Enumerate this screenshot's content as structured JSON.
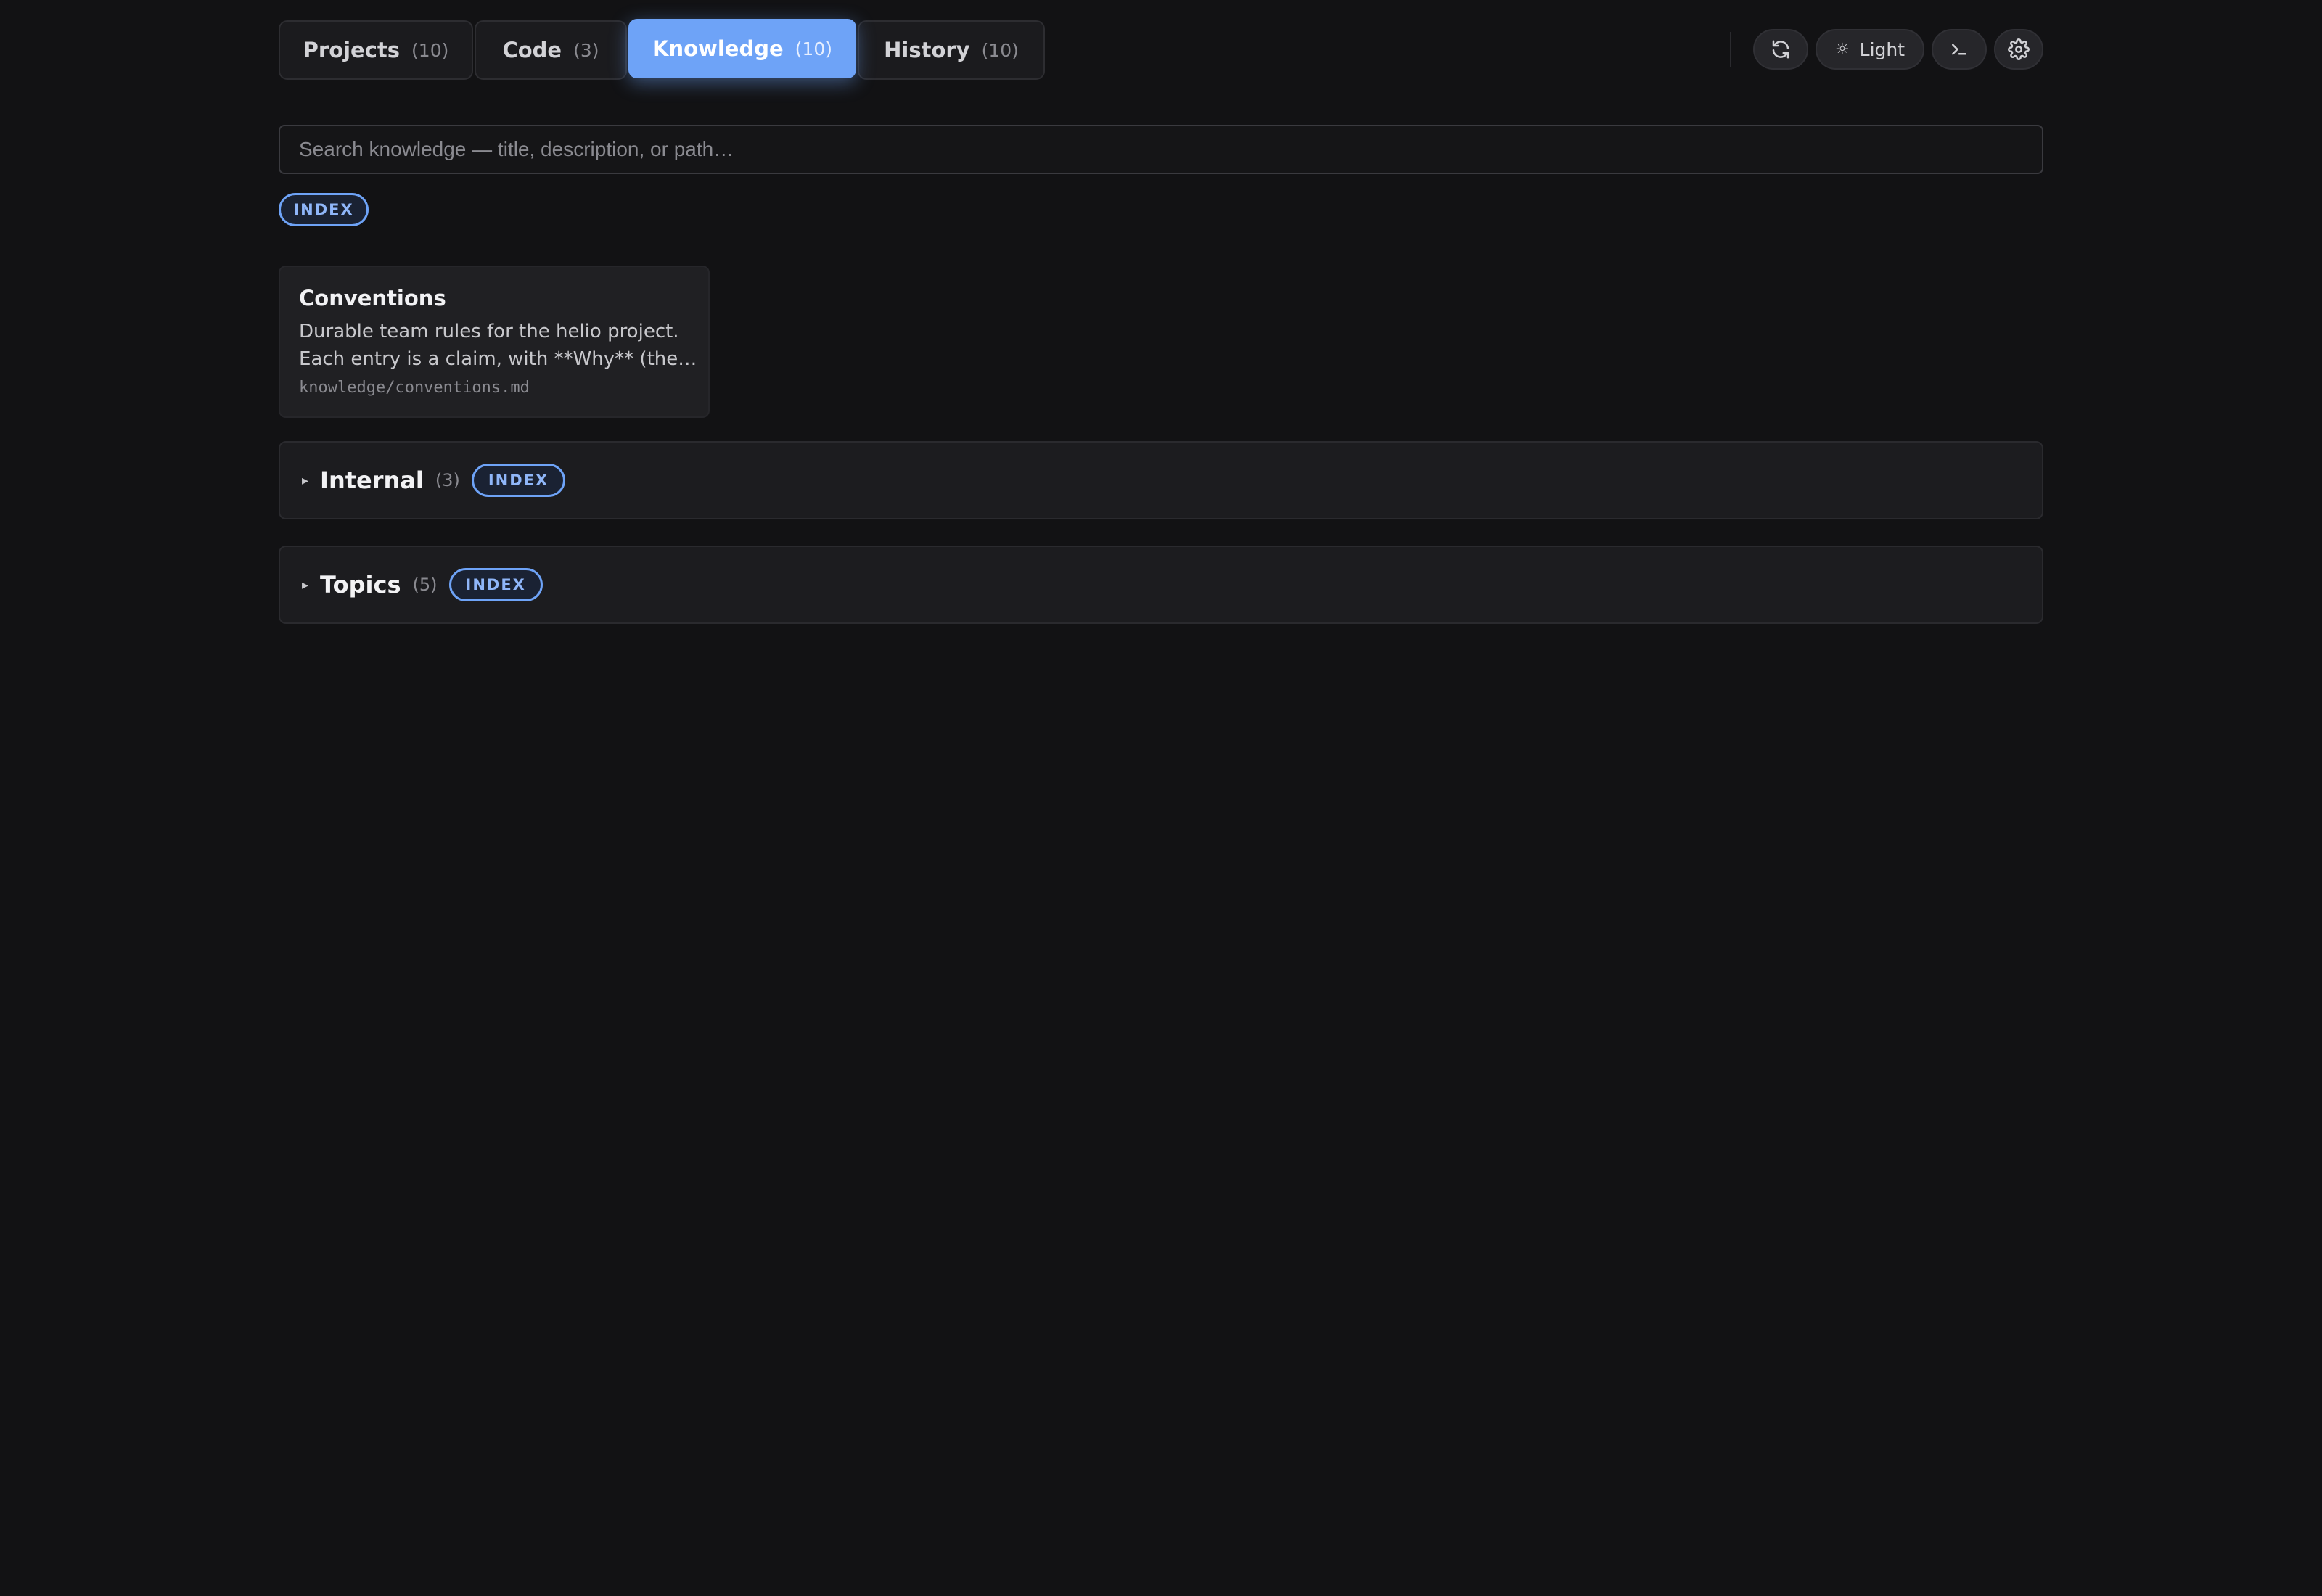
{
  "tabs": [
    {
      "label": "Projects",
      "count": "(10)"
    },
    {
      "label": "Code",
      "count": "(3)"
    },
    {
      "label": "Knowledge",
      "count": "(10)"
    },
    {
      "label": "History",
      "count": "(10)"
    }
  ],
  "active_tab": "Knowledge",
  "toolbar": {
    "refresh_icon": "refresh-icon",
    "theme_icon": "sun-icon",
    "theme_label": "Light",
    "terminal_icon": "terminal-icon",
    "settings_icon": "gear-icon"
  },
  "search": {
    "placeholder": "Search knowledge — title, description, or path…",
    "value": ""
  },
  "index_badge": "INDEX",
  "cards": [
    {
      "title": "Conventions",
      "description_line1": "Durable team rules for the helio project.",
      "description_line2": "Each entry is a claim, with **Why** (the…",
      "path": "knowledge/conventions.md"
    }
  ],
  "sections": [
    {
      "title": "Internal",
      "count": "(3)",
      "badge": "INDEX",
      "caret": "▸"
    },
    {
      "title": "Topics",
      "count": "(5)",
      "badge": "INDEX",
      "caret": "▸"
    }
  ],
  "colors": {
    "background": "#121214",
    "accent": "#6ea3f7",
    "card": "#202023"
  }
}
